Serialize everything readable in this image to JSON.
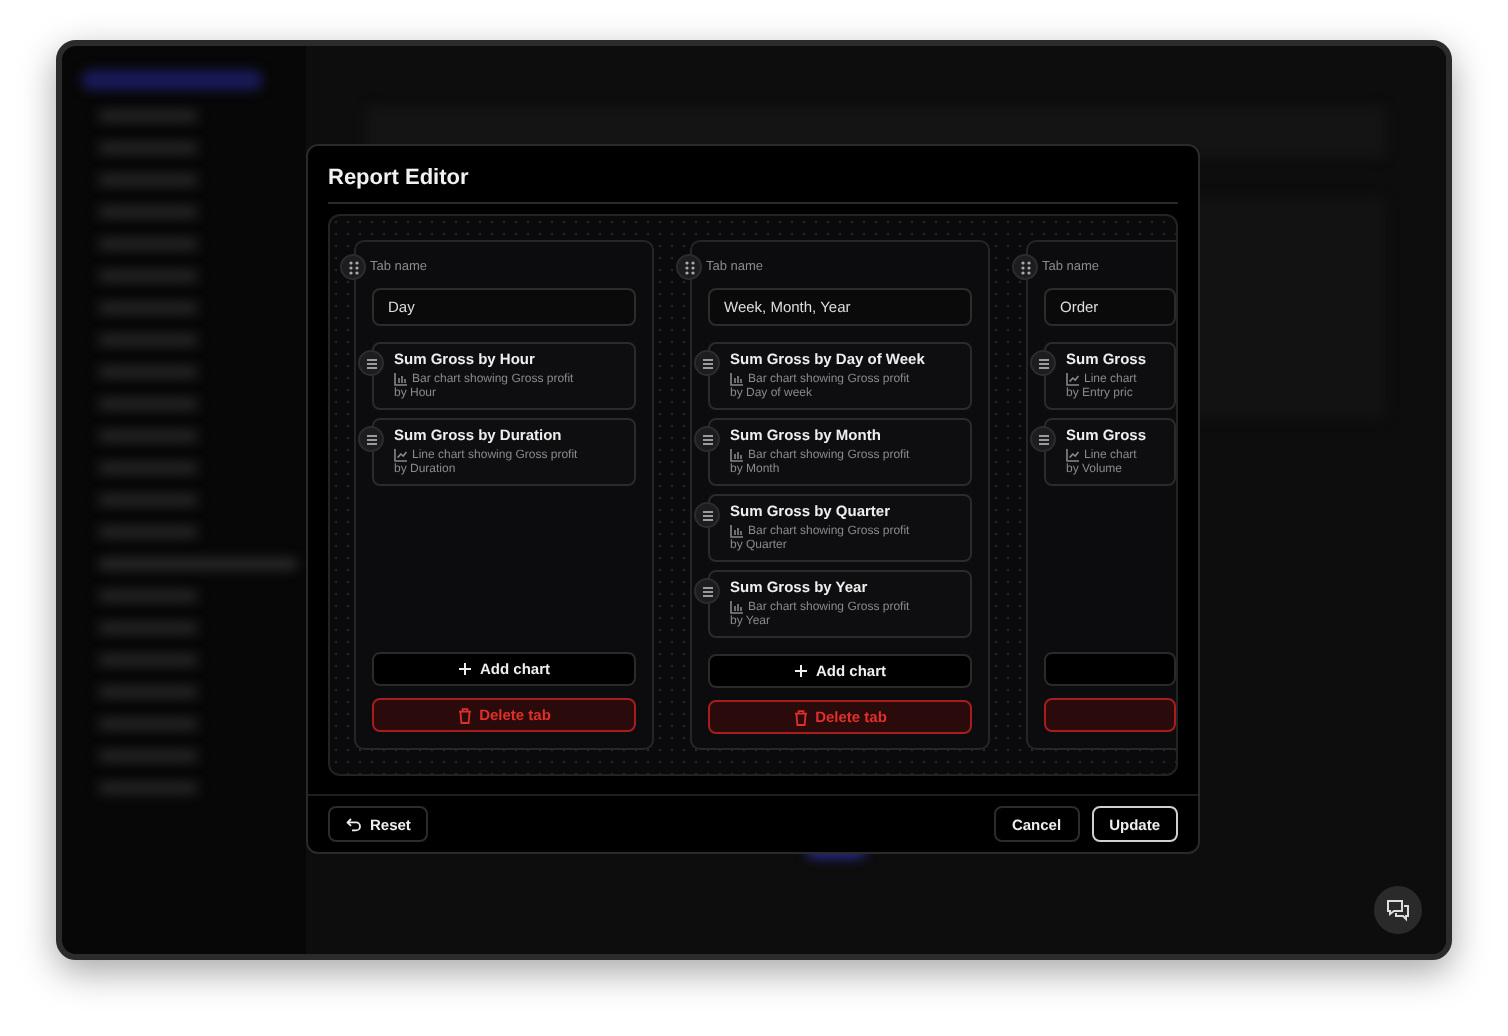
{
  "dialog": {
    "title": "Report Editor",
    "tabs": [
      {
        "label": "Tab name",
        "value": "Day",
        "add_label": "Add chart",
        "delete_label": "Delete tab",
        "charts": [
          {
            "title": "Sum Gross by Hour",
            "kind": "bar",
            "description_lines": [
              "Bar chart showing Gross profit",
              "by Hour"
            ]
          },
          {
            "title": "Sum Gross by Duration",
            "kind": "line",
            "description_lines": [
              "Line chart showing Gross profit",
              "by Duration"
            ]
          }
        ]
      },
      {
        "label": "Tab name",
        "value": "Week, Month, Year",
        "add_label": "Add chart",
        "delete_label": "Delete tab",
        "charts": [
          {
            "title": "Sum Gross by Day of Week",
            "kind": "bar",
            "description_lines": [
              "Bar chart showing Gross profit",
              "by Day of week"
            ]
          },
          {
            "title": "Sum Gross by Month",
            "kind": "bar",
            "description_lines": [
              "Bar chart showing Gross profit",
              "by Month"
            ]
          },
          {
            "title": "Sum Gross by Quarter",
            "kind": "bar",
            "description_lines": [
              "Bar chart showing Gross profit",
              "by Quarter"
            ]
          },
          {
            "title": "Sum Gross by Year",
            "kind": "bar",
            "description_lines": [
              "Bar chart showing Gross profit",
              "by Year"
            ]
          }
        ]
      },
      {
        "label": "Tab name",
        "value": "Order",
        "charts": [
          {
            "title": "Sum Gross",
            "kind": "line",
            "description_lines": [
              "Line chart",
              "by Entry pric"
            ]
          },
          {
            "title": "Sum Gross",
            "kind": "line",
            "description_lines": [
              "Line chart",
              "by Volume"
            ]
          }
        ]
      }
    ],
    "buttons": [
      {
        "label": "Reset",
        "kind": "reset"
      },
      {
        "label": "Cancel",
        "kind": "secondary"
      },
      {
        "label": "Update",
        "kind": "primary"
      }
    ]
  }
}
